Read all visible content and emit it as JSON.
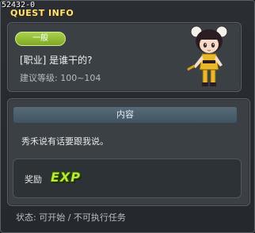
{
  "quest": {
    "id": "52432-0",
    "window_title": "QUEST INFO",
    "category": "一般",
    "name": "[职业] 是谁干的?",
    "level_text": "建议等级: 100~104",
    "content_header": "内容",
    "content_text": "秀禾说有话要跟我说。",
    "reward_label": "奖励",
    "reward_icon": "EXP",
    "status_text": "状态: 可开始 / 不可执行任务"
  },
  "colors": {
    "title": "#ffe27a",
    "badge": "#8fbb2f",
    "exp": "#b8e83a",
    "content_header": "#4b5e6c"
  },
  "icons": {
    "npc": "npc-portrait-icon",
    "reward": "exp-reward-icon"
  }
}
